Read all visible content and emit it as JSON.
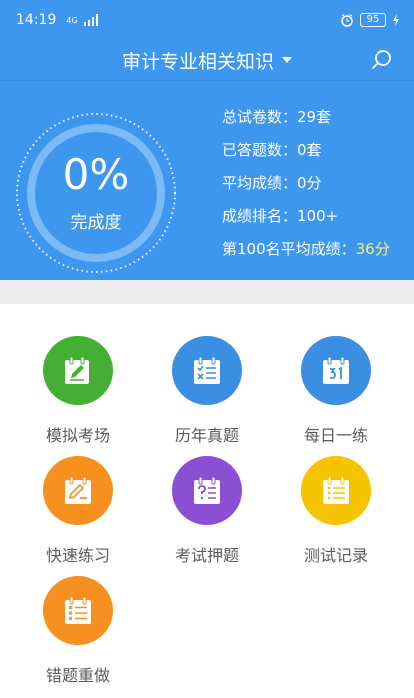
{
  "status_bar": {
    "time": "14:19",
    "network": "4G",
    "battery": "95"
  },
  "header": {
    "title": "审计专业相关知识"
  },
  "progress": {
    "value": "0%",
    "label": "完成度"
  },
  "stats": [
    {
      "label": "总试卷数：",
      "value": "29套"
    },
    {
      "label": "已答题数：",
      "value": "0套"
    },
    {
      "label": "平均成绩：",
      "value": "0分"
    },
    {
      "label": "成绩排名：",
      "value": "100+"
    },
    {
      "label": "第100名平均成绩：",
      "value": "36分"
    }
  ],
  "menu": [
    {
      "label": "模拟考场",
      "icon": "edit-notepad-icon",
      "color": "#43b033"
    },
    {
      "label": "历年真题",
      "icon": "checklist-notepad-icon",
      "color": "#3b8fe3"
    },
    {
      "label": "每日一练",
      "icon": "calendar-icon",
      "color": "#3b8fe3"
    },
    {
      "label": "快速练习",
      "icon": "quick-edit-notepad-icon",
      "color": "#f6901e"
    },
    {
      "label": "考试押题",
      "icon": "question-notepad-icon",
      "color": "#8a4fd4"
    },
    {
      "label": "测试记录",
      "icon": "list-notepad-icon",
      "color": "#f7c300"
    },
    {
      "label": "错题重做",
      "icon": "wrong-list-notepad-icon",
      "color": "#f6901e"
    }
  ],
  "colors": {
    "primary": "#3d97ee",
    "highlight": "#f5ef7a"
  }
}
